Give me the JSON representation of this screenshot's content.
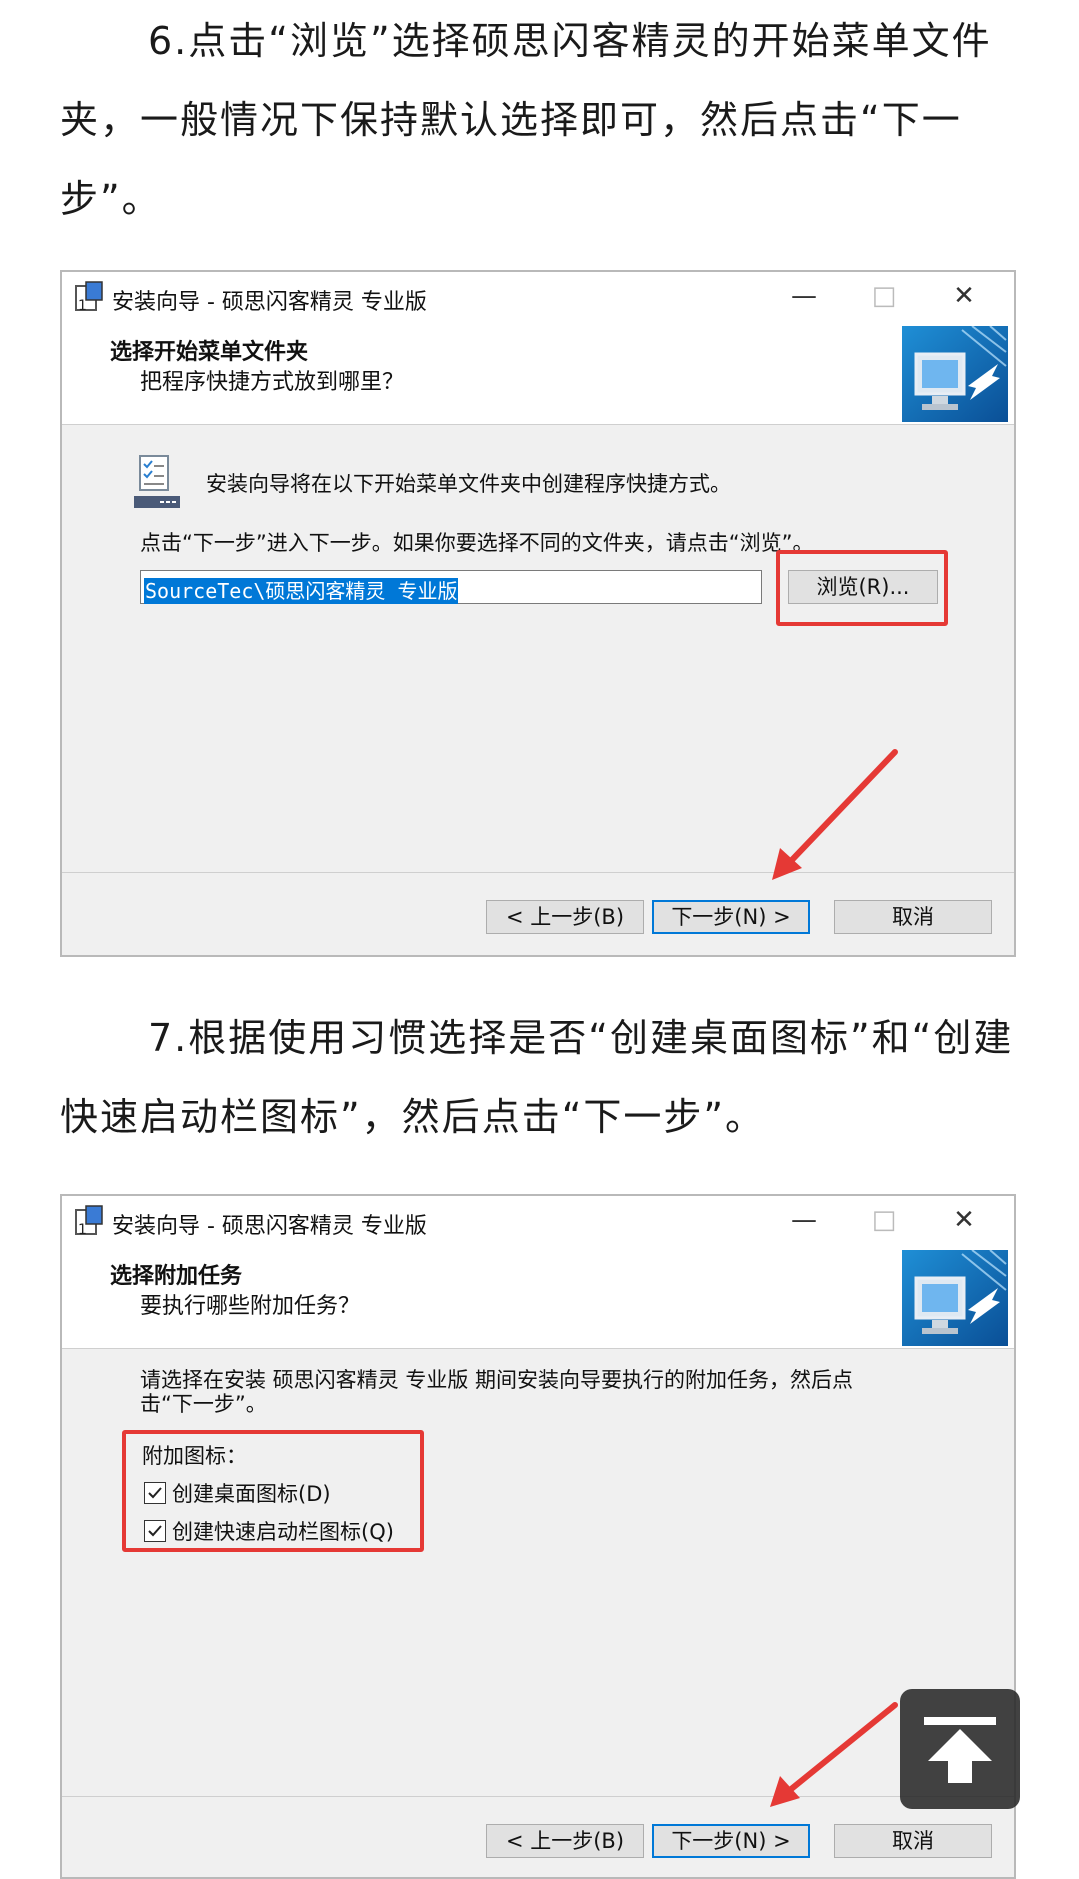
{
  "step6": {
    "text": "6.点击“浏览”选择硕思闪客精灵的开始菜单文件夹，一般情况下保持默认选择即可，然后点击“下一步”。"
  },
  "dialog1": {
    "window_title": "安装向导 - 硕思闪客精灵 专业版",
    "minimize": "—",
    "maximize": "□",
    "close": "✕",
    "header_title": "选择开始菜单文件夹",
    "header_subtitle": "把程序快捷方式放到哪里？",
    "info_text": "安装向导将在以下开始菜单文件夹中创建程序快捷方式。",
    "instruction": "点击“下一步”进入下一步。如果你要选择不同的文件夹，请点击“浏览”。",
    "folder_value": "SourceTec\\硕思闪客精灵 专业版",
    "browse_button": "浏览(R)...",
    "back_button": "< 上一步(B)",
    "next_button": "下一步(N) >",
    "cancel_button": "取消"
  },
  "step7": {
    "text": "7.根据使用习惯选择是否“创建桌面图标”和“创建快速启动栏图标”，然后点击“下一步”。"
  },
  "dialog2": {
    "window_title": "安装向导 - 硕思闪客精灵 专业版",
    "minimize": "—",
    "maximize": "□",
    "close": "✕",
    "header_title": "选择附加任务",
    "header_subtitle": "要执行哪些附加任务？",
    "instruction_line1": "请选择在安装 硕思闪客精灵 专业版 期间安装向导要执行的附加任务，然后点",
    "instruction_line2": "击“下一步”。",
    "group_label": "附加图标：",
    "options": [
      {
        "label": "创建桌面图标(D)",
        "checked": true
      },
      {
        "label": "创建快速启动栏图标(Q)",
        "checked": true
      }
    ],
    "back_button": "< 上一步(B)",
    "next_button": "下一步(N) >",
    "cancel_button": "取消"
  },
  "icons": {
    "app": "installer-icon",
    "header": "computer-shortcut-icon",
    "info": "checklist-icon",
    "back_to_top": "arrow-up-icon"
  },
  "colors": {
    "highlight_red": "#e53935",
    "selection_blue": "#0078d7",
    "dialog_bg": "#f0f0f0"
  }
}
